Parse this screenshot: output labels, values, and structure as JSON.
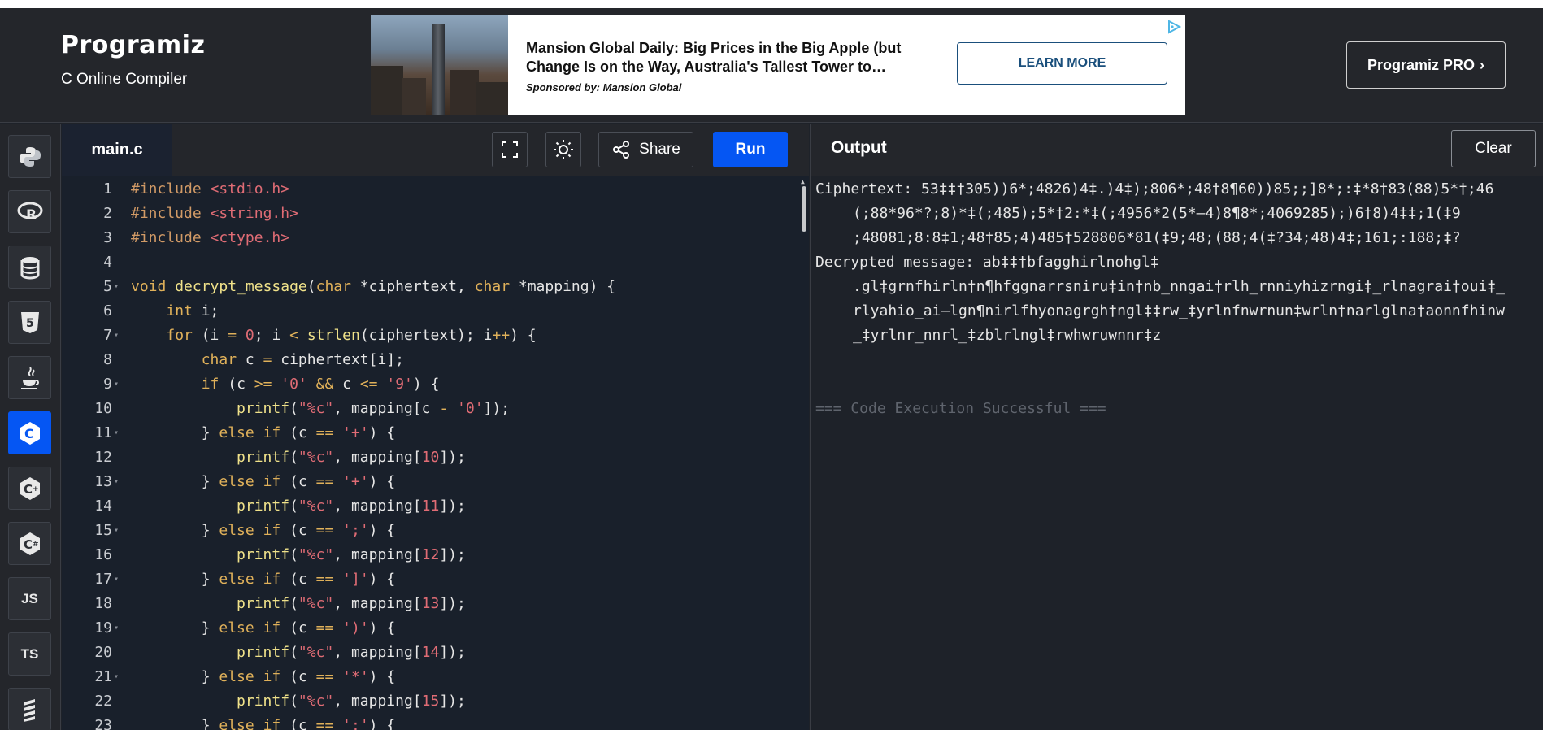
{
  "header": {
    "logo": "Programiz",
    "subtitle": "C Online Compiler",
    "pro_button": "Programiz PRO",
    "pro_chevron": "›"
  },
  "ad": {
    "title": "Mansion Global Daily: Big Prices in the Big Apple (but Change Is on the Way, Australia's Tallest Tower to…",
    "sponsor": "Sponsored by: Mansion Global",
    "cta": "LEARN MORE"
  },
  "rail": {
    "items": [
      {
        "name": "python",
        "label": ""
      },
      {
        "name": "r",
        "label": ""
      },
      {
        "name": "sql",
        "label": ""
      },
      {
        "name": "html",
        "label": ""
      },
      {
        "name": "java",
        "label": ""
      },
      {
        "name": "c",
        "label": "",
        "active": true
      },
      {
        "name": "cpp",
        "label": ""
      },
      {
        "name": "csharp",
        "label": ""
      },
      {
        "name": "js",
        "label": "JS"
      },
      {
        "name": "ts",
        "label": "TS"
      },
      {
        "name": "go",
        "label": ""
      }
    ]
  },
  "editor": {
    "tab": "main.c",
    "share_label": "Share",
    "run_label": "Run",
    "lines": [
      "#include <stdio.h>",
      "#include <string.h>",
      "#include <ctype.h>",
      "",
      "void decrypt_message(char *ciphertext, char *mapping) {",
      "    int i;",
      "    for (i = 0; i < strlen(ciphertext); i++) {",
      "        char c = ciphertext[i];",
      "        if (c >= '0' && c <= '9') {",
      "            printf(\"%c\", mapping[c - '0']);",
      "        } else if (c == '+') {",
      "            printf(\"%c\", mapping[10]);",
      "        } else if (c == '+') {",
      "            printf(\"%c\", mapping[11]);",
      "        } else if (c == ';') {",
      "            printf(\"%c\", mapping[12]);",
      "        } else if (c == ']') {",
      "            printf(\"%c\", mapping[13]);",
      "        } else if (c == ')') {",
      "            printf(\"%c\", mapping[14]);",
      "        } else if (c == '*') {",
      "            printf(\"%c\", mapping[15]);",
      "        } else if (c == ':') {"
    ],
    "fold_lines": [
      5,
      7,
      9,
      11,
      13,
      15,
      17,
      19,
      21
    ]
  },
  "output": {
    "title": "Output",
    "clear_label": "Clear",
    "lines": [
      {
        "text": "Ciphertext: 53‡‡†305))6*;4826)4‡.)4‡);806*;48†8¶60))85;;]8*;:‡*8†83(88)5*†;46",
        "indent": false
      },
      {
        "text": "(;88*96*?;8)*‡(;485);5*†2:*‡(;4956*2(5*—4)8¶8*;4069285);)6†8)4‡‡;1(‡9",
        "indent": true
      },
      {
        "text": ";48081;8:8‡1;48†85;4)485†528806*81(‡9;48;(88;4(‡?34;48)4‡;161;:188;‡?",
        "indent": true
      },
      {
        "text": "Decrypted message: ab‡‡†bfagghirlnohgl‡",
        "indent": false
      },
      {
        "text": ".gl‡grnfhirln†n¶hfggnarrsniru‡in†nb_nngai†rlh_rnniyhizrngi‡_rlnagrai†oui‡_",
        "indent": true
      },
      {
        "text": "rlyahio_ai—lgn¶nirlfhyonagrgh†ngl‡‡rw_‡yrlnfnwrnun‡wrln†narlglna†aonnfhinw",
        "indent": true
      },
      {
        "text": "_‡yrlnr_nnrl_‡zblrlngl‡rwhwruwnnr‡z",
        "indent": true
      },
      {
        "text": "",
        "indent": false
      },
      {
        "text": "",
        "indent": false
      },
      {
        "text": "=== Code Execution Successful ===",
        "indent": false,
        "dim": true
      }
    ]
  },
  "colors": {
    "accent": "#0556f3",
    "background": "#1e2229",
    "editor_bg": "#19202b",
    "header_bg": "#24262b"
  }
}
